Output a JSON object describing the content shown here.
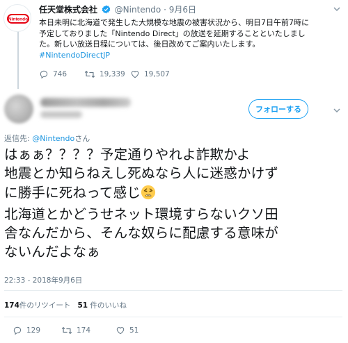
{
  "quoted_tweet": {
    "name": "任天堂株式会社",
    "handle": "@Nintendo",
    "separator": "·",
    "date": "9月6日",
    "avatar_text": "Nintendo",
    "body_line1": "本日未明に北海道で発生した大規模な地震の被害状況から、明日7日午前7時に",
    "body_line2": "予定しておりました「Nintendo Direct」の放送を延期することといたしまし",
    "body_line3": "た。新しい放送日程については、後日改めてご案内いたします。",
    "hashtag": "#NintendoDirectJP",
    "replies": "746",
    "retweets": "19,339",
    "likes": "19,507",
    "brand_color": "#e60012"
  },
  "reply_tweet": {
    "follow_label": "フォローする",
    "reply_prefix": "返信先: ",
    "reply_mention": "@Nintendo",
    "reply_suffix": "さん",
    "text_line1": "はぁぁ？？？？予定通りやれよ詐欺かよ",
    "text_line2": "地震とか知らねえし死ぬなら人に迷惑かけず",
    "text_line3": "に勝手に死ねって感じ",
    "text_line4": "北海道とかどうせネット環境すらないクソ田",
    "text_line5": "舎なんだから、そんな奴らに配慮する意味が",
    "text_line6": "ないんだよなぁ",
    "emoji": "weary-face-icon",
    "timestamp": "22:33 - 2018年9月6日",
    "retweet_count": "174",
    "retweet_label": "件のリツイート",
    "like_count": "51",
    "like_label": " 件のいいね",
    "replies": "129",
    "retweets": "174",
    "likes": "51",
    "accent_color": "#1da1f2"
  }
}
